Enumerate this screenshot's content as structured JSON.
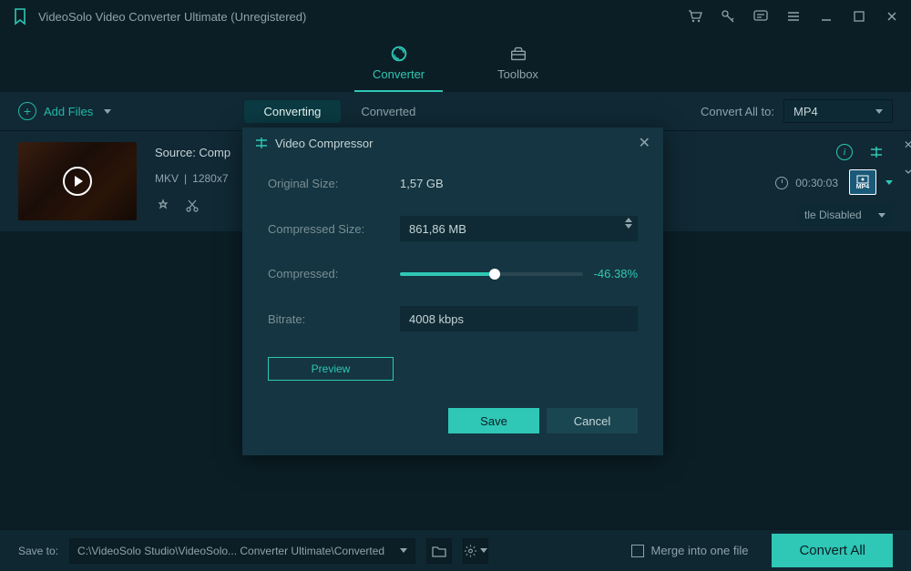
{
  "titlebar": {
    "title": "VideoSolo Video Converter Ultimate (Unregistered)"
  },
  "top_tabs": {
    "converter": "Converter",
    "toolbox": "Toolbox"
  },
  "toolbar": {
    "add_files": "Add Files",
    "converting": "Converting",
    "converted": "Converted",
    "convert_all_to_label": "Convert All to:",
    "convert_all_to_value": "MP4"
  },
  "file": {
    "source_prefix": "Source: Comp",
    "container": "MKV",
    "resolution": "1280x7",
    "duration": "00:30:03",
    "subtitle": "tle Disabled",
    "format": "MP4"
  },
  "bottom": {
    "save_to_label": "Save to:",
    "path": "C:\\VideoSolo Studio\\VideoSolo... Converter Ultimate\\Converted",
    "merge_label": "Merge into one file",
    "convert_all": "Convert All"
  },
  "modal": {
    "title": "Video Compressor",
    "original_size_label": "Original Size:",
    "original_size_value": "1,57 GB",
    "compressed_size_label": "Compressed Size:",
    "compressed_size_value": "861,86 MB",
    "compressed_label": "Compressed:",
    "compressed_percent": "-46.38%",
    "bitrate_label": "Bitrate:",
    "bitrate_value": "4008 kbps",
    "preview": "Preview",
    "save": "Save",
    "cancel": "Cancel"
  }
}
